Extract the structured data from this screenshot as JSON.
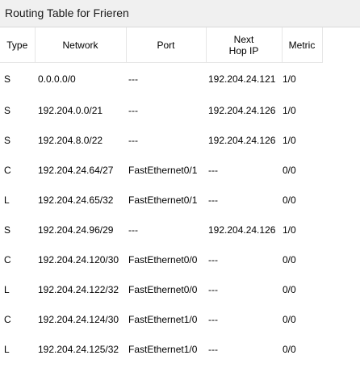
{
  "window": {
    "title": "Routing Table for Frieren"
  },
  "table": {
    "columns": [
      {
        "key": "type",
        "label": "Type"
      },
      {
        "key": "network",
        "label": "Network"
      },
      {
        "key": "port",
        "label": "Port"
      },
      {
        "key": "next_hop",
        "label_line1": "Next",
        "label_line2": "Hop IP"
      },
      {
        "key": "metric",
        "label": "Metric"
      }
    ],
    "rows": [
      {
        "type": "S",
        "network": "0.0.0.0/0",
        "port": "---",
        "next_hop": "192.204.24.121",
        "metric": "1/0"
      },
      {
        "type": "S",
        "network": "192.204.0.0/21",
        "port": "---",
        "next_hop": "192.204.24.126",
        "metric": "1/0"
      },
      {
        "type": "S",
        "network": "192.204.8.0/22",
        "port": "---",
        "next_hop": "192.204.24.126",
        "metric": "1/0"
      },
      {
        "type": "C",
        "network": "192.204.24.64/27",
        "port": "FastEthernet0/1",
        "next_hop": "---",
        "metric": "0/0"
      },
      {
        "type": "L",
        "network": "192.204.24.65/32",
        "port": "FastEthernet0/1",
        "next_hop": "---",
        "metric": "0/0"
      },
      {
        "type": "S",
        "network": "192.204.24.96/29",
        "port": "---",
        "next_hop": "192.204.24.126",
        "metric": "1/0"
      },
      {
        "type": "C",
        "network": "192.204.24.120/30",
        "port": "FastEthernet0/0",
        "next_hop": "---",
        "metric": "0/0"
      },
      {
        "type": "L",
        "network": "192.204.24.122/32",
        "port": "FastEthernet0/0",
        "next_hop": "---",
        "metric": "0/0"
      },
      {
        "type": "C",
        "network": "192.204.24.124/30",
        "port": "FastEthernet1/0",
        "next_hop": "---",
        "metric": "0/0"
      },
      {
        "type": "L",
        "network": "192.204.24.125/32",
        "port": "FastEthernet1/0",
        "next_hop": "---",
        "metric": "0/0"
      }
    ]
  }
}
